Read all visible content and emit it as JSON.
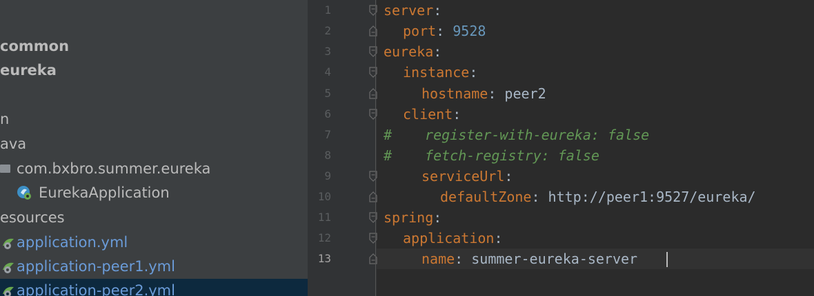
{
  "project_tree": {
    "items": [
      {
        "label": "common",
        "kind": "module"
      },
      {
        "label": "eureka",
        "kind": "module"
      },
      {
        "label": "n",
        "kind": "folder"
      },
      {
        "label": "ava",
        "kind": "folder"
      },
      {
        "label": "com.bxbro.summer.eureka",
        "kind": "package",
        "icon": "package-icon"
      },
      {
        "label": "EurekaApplication",
        "kind": "class",
        "icon": "spring-boot-class-icon"
      },
      {
        "label": "esources",
        "kind": "folder"
      },
      {
        "label": "application.yml",
        "kind": "yml",
        "icon": "spring-yml-icon"
      },
      {
        "label": "application-peer1.yml",
        "kind": "yml",
        "icon": "spring-yml-icon"
      },
      {
        "label": "application-peer2.yml",
        "kind": "yml",
        "icon": "spring-yml-icon",
        "selected": true
      }
    ]
  },
  "editor": {
    "current_line": "13",
    "line_numbers": [
      "1",
      "2",
      "3",
      "4",
      "5",
      "6",
      "7",
      "8",
      "9",
      "10",
      "11",
      "12",
      "13"
    ],
    "lines": [
      {
        "key": "server",
        "sep": ":"
      },
      {
        "key": "port",
        "sep": ": ",
        "number": "9528"
      },
      {
        "key": "eureka",
        "sep": ":"
      },
      {
        "key": "instance",
        "sep": ":"
      },
      {
        "key": "hostname",
        "sep": ": ",
        "value": "peer2"
      },
      {
        "key": "client",
        "sep": ":"
      },
      {
        "comment_mark": "#",
        "comment": "register-with-eureka: false"
      },
      {
        "comment_mark": "#",
        "comment": "fetch-registry: false"
      },
      {
        "key": "serviceUrl",
        "sep": ":"
      },
      {
        "key": "defaultZone",
        "sep": ": ",
        "value": "http://peer1:9527/eureka/"
      },
      {
        "key": "spring",
        "sep": ":"
      },
      {
        "key": "application",
        "sep": ":"
      },
      {
        "key": "name",
        "sep": ": ",
        "value": "summer-eureka-server"
      }
    ]
  },
  "colors": {
    "keyword": "#cc7832",
    "number": "#6897bb",
    "text": "#a9b7c6",
    "comment": "#629755",
    "selection": "#0d293e"
  }
}
